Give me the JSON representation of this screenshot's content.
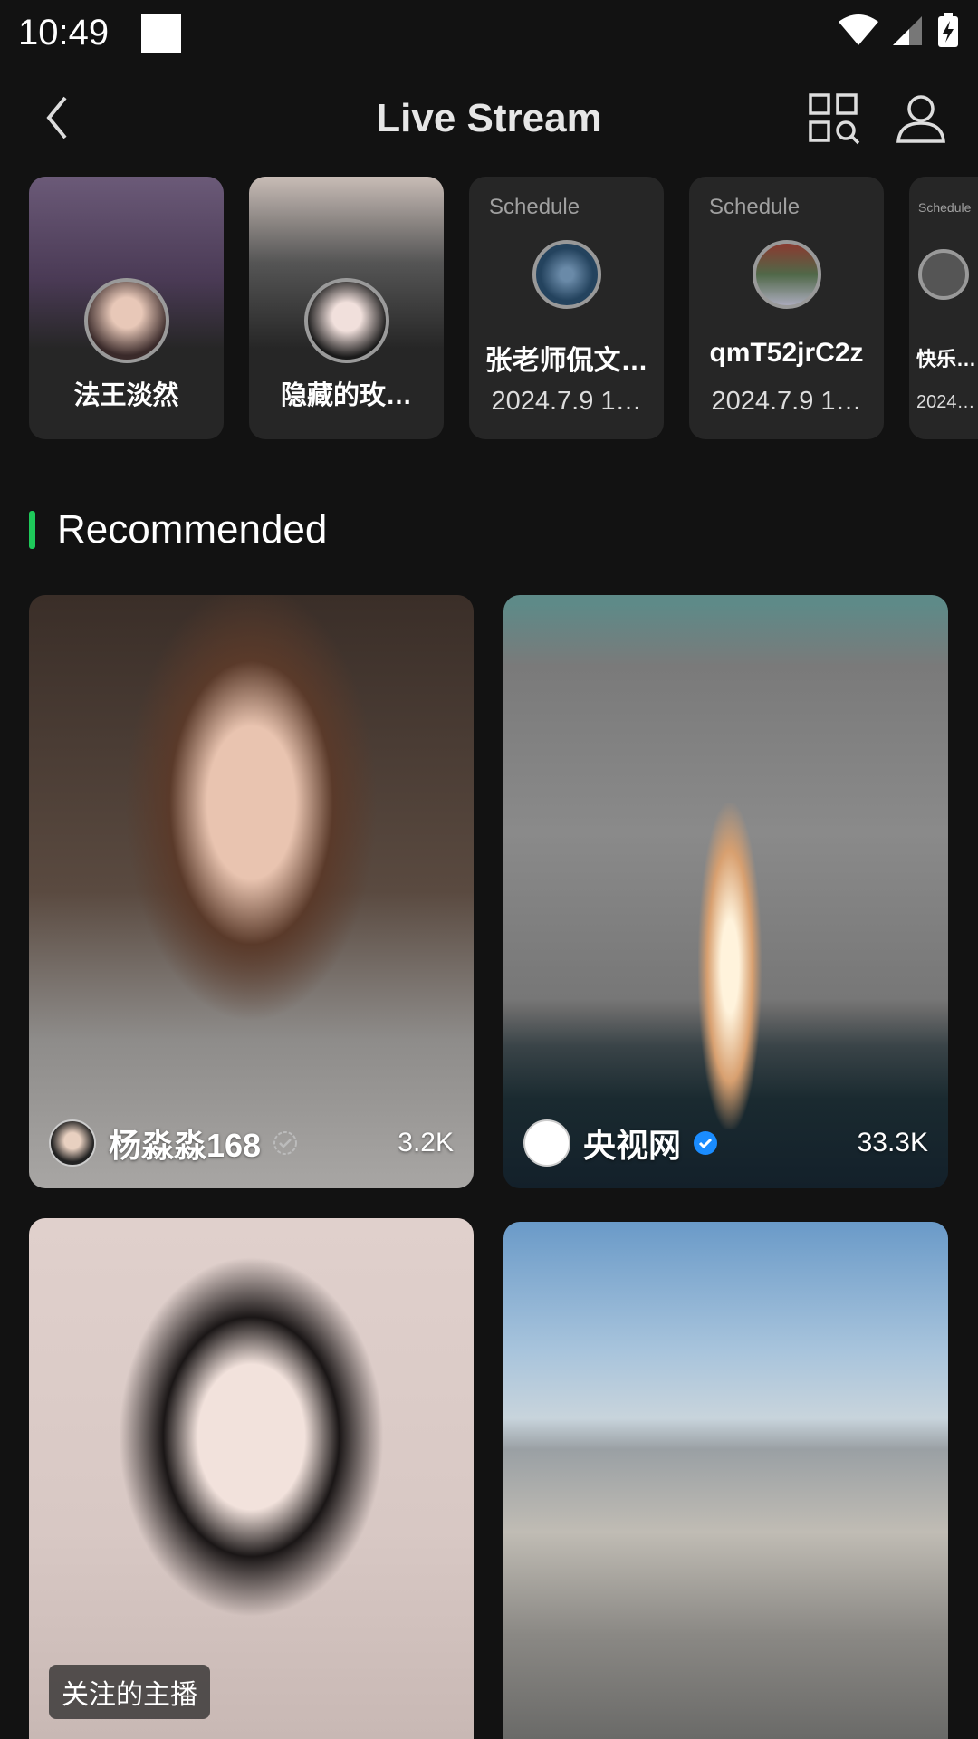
{
  "status_bar": {
    "time": "10:49"
  },
  "header": {
    "title": "Live Stream",
    "back_icon": "chevron-left-icon",
    "scan_icon": "grid-search-icon",
    "profile_icon": "user-icon"
  },
  "top_row": [
    {
      "type": "live",
      "name": "法王淡然"
    },
    {
      "type": "live",
      "name": "隐藏的玫…"
    },
    {
      "type": "schedule",
      "label": "Schedule",
      "name": "张老师侃文…",
      "date": "2024.7.9 1…"
    },
    {
      "type": "schedule",
      "label": "Schedule",
      "name": "qmT52jrC2z",
      "date": "2024.7.9 1…"
    },
    {
      "type": "schedule",
      "label": "Schedule",
      "name": "快乐…",
      "date": "2024…"
    }
  ],
  "section": {
    "title": "Recommended",
    "accent": "#1ec95a"
  },
  "streams": [
    {
      "name": "杨淼淼168",
      "viewers": "3.2K",
      "verified": false
    },
    {
      "name": "央视网",
      "viewers": "33.3K",
      "verified": true,
      "badge_color": "#1a8cff"
    },
    {
      "label": "关注的主播"
    },
    {}
  ]
}
